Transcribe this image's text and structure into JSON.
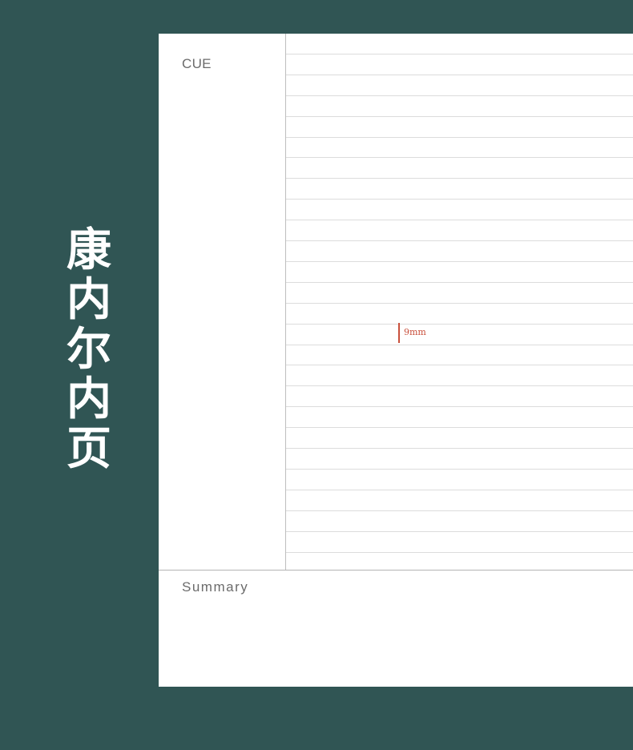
{
  "title_chars": [
    "康",
    "内",
    "尔",
    "内",
    "页"
  ],
  "notebook": {
    "cue_label": "CUE",
    "summary_label": "Summary",
    "ruled_lines": 25,
    "line_spacing_label": "9mm"
  },
  "colors": {
    "background": "#305554",
    "paper": "#ffffff",
    "rule": "#dcdcdc",
    "accent": "#c9503c",
    "label_text": "#6b6b6b"
  }
}
